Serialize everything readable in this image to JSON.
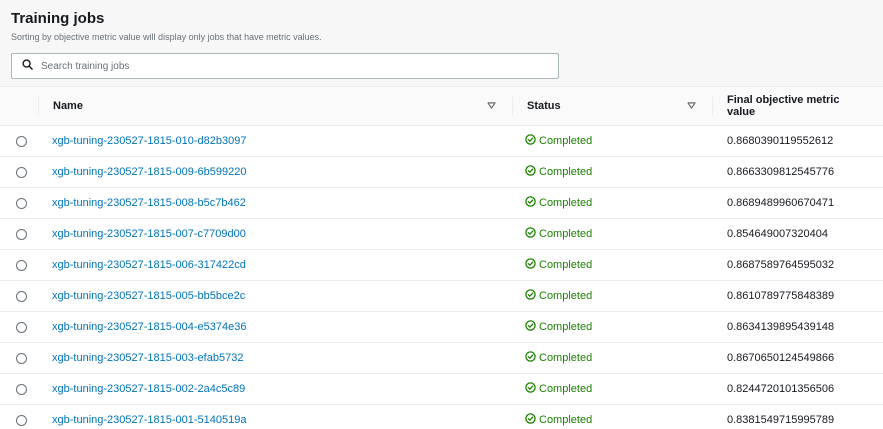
{
  "header": {
    "title": "Training jobs",
    "subtitle": "Sorting by objective metric value will display only jobs that have metric values."
  },
  "search": {
    "placeholder": "Search training jobs",
    "value": ""
  },
  "columns": {
    "name": "Name",
    "status": "Status",
    "metric": "Final objective metric value"
  },
  "colors": {
    "link": "#0073bb",
    "success": "#1d8102"
  },
  "icons": {
    "search": "search-icon",
    "sort": "caret-down-icon",
    "status": "check-circle-icon"
  },
  "rows": [
    {
      "name": "xgb-tuning-230527-1815-010-d82b3097",
      "status": "Completed",
      "metric": "0.8680390119552612"
    },
    {
      "name": "xgb-tuning-230527-1815-009-6b599220",
      "status": "Completed",
      "metric": "0.8663309812545776"
    },
    {
      "name": "xgb-tuning-230527-1815-008-b5c7b462",
      "status": "Completed",
      "metric": "0.8689489960670471"
    },
    {
      "name": "xgb-tuning-230527-1815-007-c7709d00",
      "status": "Completed",
      "metric": "0.854649007320404"
    },
    {
      "name": "xgb-tuning-230527-1815-006-317422cd",
      "status": "Completed",
      "metric": "0.8687589764595032"
    },
    {
      "name": "xgb-tuning-230527-1815-005-bb5bce2c",
      "status": "Completed",
      "metric": "0.8610789775848389"
    },
    {
      "name": "xgb-tuning-230527-1815-004-e5374e36",
      "status": "Completed",
      "metric": "0.8634139895439148"
    },
    {
      "name": "xgb-tuning-230527-1815-003-efab5732",
      "status": "Completed",
      "metric": "0.8670650124549866"
    },
    {
      "name": "xgb-tuning-230527-1815-002-2a4c5c89",
      "status": "Completed",
      "metric": "0.8244720101356506"
    },
    {
      "name": "xgb-tuning-230527-1815-001-5140519a",
      "status": "Completed",
      "metric": "0.8381549715995789"
    }
  ]
}
